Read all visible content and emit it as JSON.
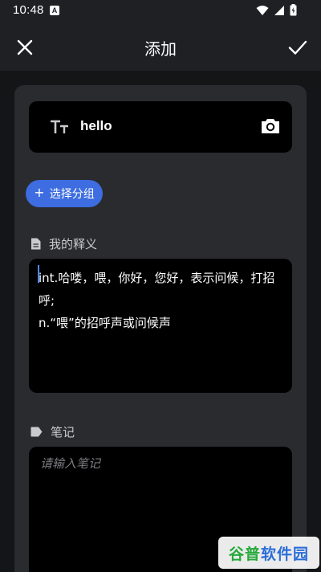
{
  "status_bar": {
    "time": "10:48",
    "notification_badge": "A"
  },
  "app_bar": {
    "title": "添加",
    "close_icon": "close-icon",
    "confirm_icon": "check-icon"
  },
  "word_field": {
    "value": "hello",
    "format_icon": "text-size-icon",
    "camera_icon": "camera-icon"
  },
  "group_button": {
    "plus": "+",
    "label": "选择分组"
  },
  "definition_section": {
    "label": "我的释义",
    "icon": "document-icon",
    "value": "int.哈喽，喂，你好，您好，表示问候，打招呼;\nn.“喂”的招呼声或问候声"
  },
  "note_section": {
    "label": "笔记",
    "icon": "label-icon",
    "placeholder": "请输入笔记"
  },
  "watermark": {
    "part1": "谷普",
    "part2": "软件园"
  },
  "colors": {
    "accent": "#3d6de0",
    "background": "#1f2024",
    "card": "#2a2b2f",
    "field": "#000000"
  }
}
